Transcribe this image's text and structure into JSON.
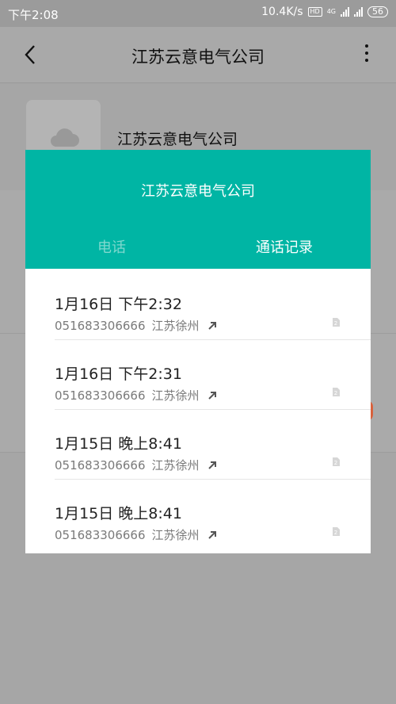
{
  "status_bar": {
    "time": "下午2:08",
    "net_speed": "10.4K/s",
    "hd": "HD",
    "network": "4G",
    "battery": "56"
  },
  "header": {
    "title": "江苏云意电气公司"
  },
  "contact": {
    "name": "江苏云意电气公司"
  },
  "dialog": {
    "title": "江苏云意电气公司",
    "tabs": [
      {
        "label": "电话",
        "active": false
      },
      {
        "label": "通话记录",
        "active": true
      }
    ],
    "call_log": [
      {
        "datetime": "1月16日 下午2:32",
        "number": "051683306666",
        "location": "江苏徐州",
        "direction": "outgoing",
        "sim": "2"
      },
      {
        "datetime": "1月16日 下午2:31",
        "number": "051683306666",
        "location": "江苏徐州",
        "direction": "outgoing",
        "sim": "2"
      },
      {
        "datetime": "1月15日 晚上8:41",
        "number": "051683306666",
        "location": "江苏徐州",
        "direction": "outgoing",
        "sim": "2"
      },
      {
        "datetime": "1月15日 晚上8:41",
        "number": "051683306666",
        "location": "江苏徐州",
        "direction": "outgoing",
        "sim": "2"
      }
    ]
  },
  "colors": {
    "accent": "#00b5a4",
    "scrim": "#a6a6a6"
  }
}
